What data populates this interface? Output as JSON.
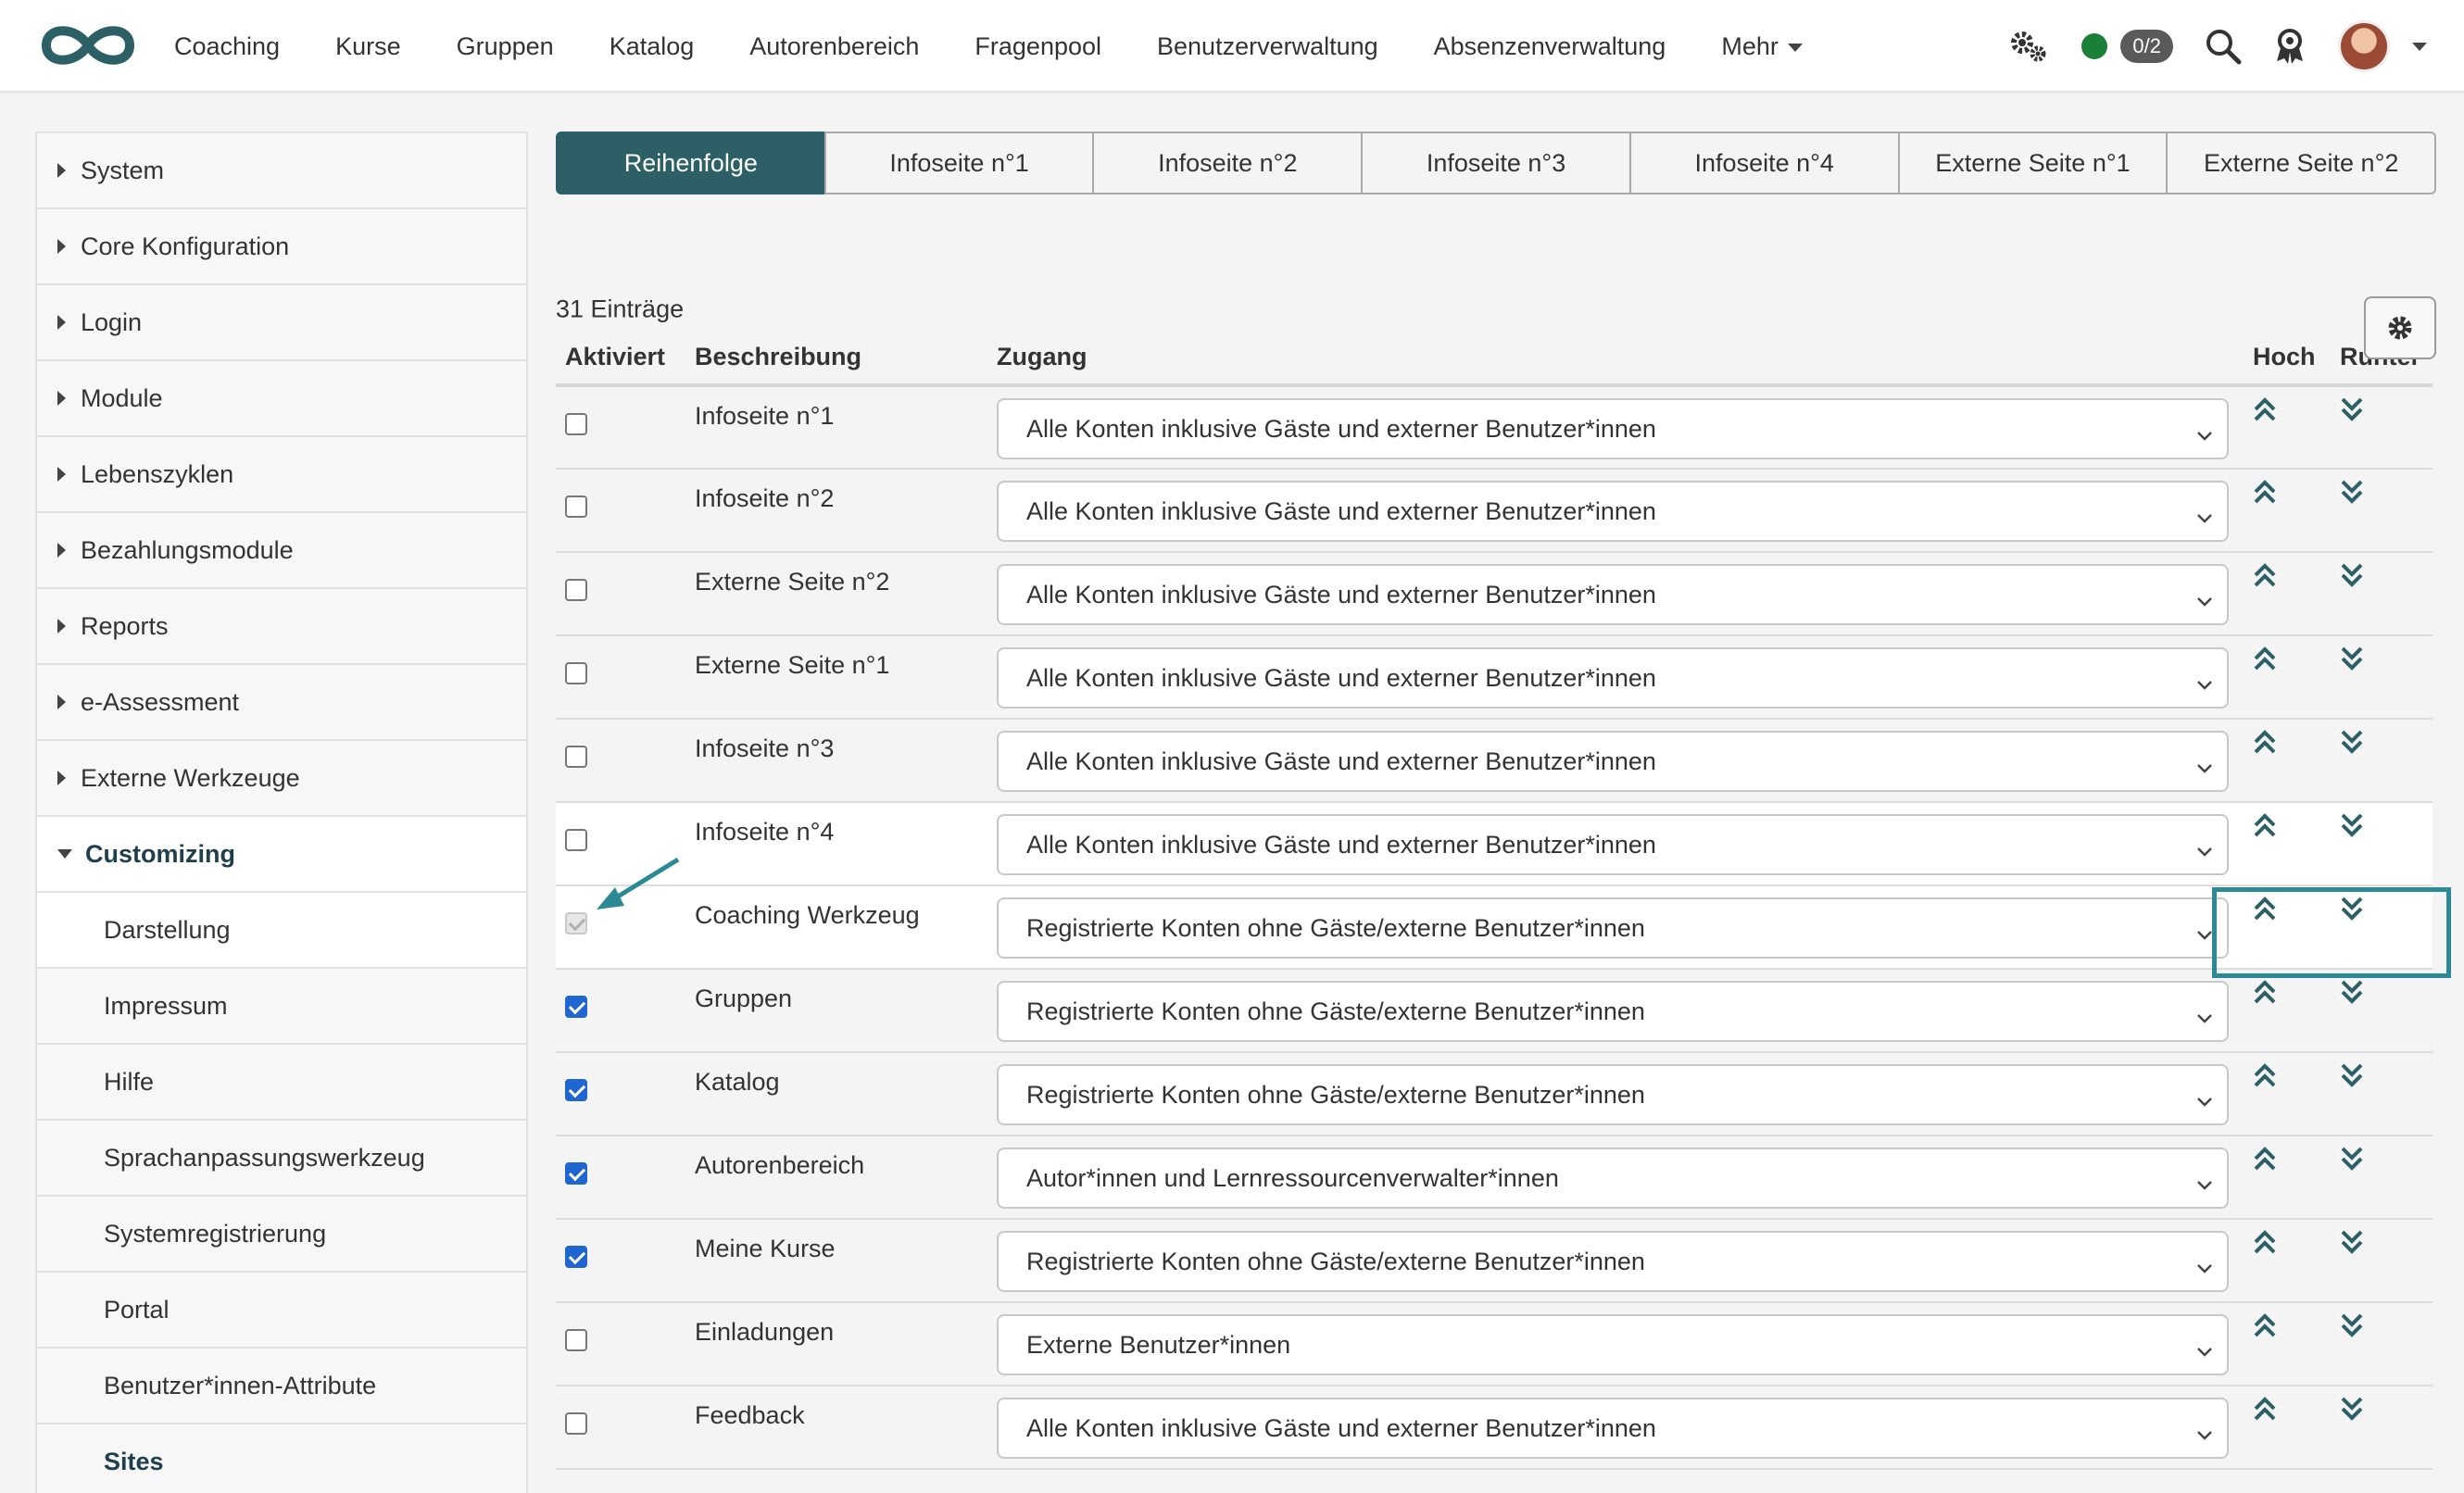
{
  "colors": {
    "accent": "#2c6066",
    "highlight": "#2c8a96",
    "checkbox": "#1f66d0",
    "status_online": "#1a7f37"
  },
  "nav": {
    "items": [
      "Coaching",
      "Kurse",
      "Gruppen",
      "Katalog",
      "Autorenbereich",
      "Fragenpool",
      "Benutzerverwaltung",
      "Absenzenverwaltung"
    ],
    "more_label": "Mehr",
    "badge": "0/2"
  },
  "sidebar": {
    "groups": [
      "System",
      "Core Konfiguration",
      "Login",
      "Module",
      "Lebenszyklen",
      "Bezahlungsmodule",
      "Reports",
      "e-Assessment",
      "Externe Werkzeuge"
    ],
    "open_group": "Customizing",
    "sub_items": [
      "Darstellung",
      "Impressum",
      "Hilfe",
      "Sprachanpassungswerkzeug",
      "Systemregistrierung",
      "Portal",
      "Benutzer*innen-Attribute"
    ],
    "active_sub": "Sites"
  },
  "tabs": [
    "Reihenfolge",
    "Infoseite n°1",
    "Infoseite n°2",
    "Infoseite n°3",
    "Infoseite n°4",
    "Externe Seite n°1",
    "Externe Seite n°2"
  ],
  "entries": "31 Einträge",
  "table": {
    "headers": [
      "Aktiviert",
      "Beschreibung",
      "Zugang",
      "Hoch",
      "Runter"
    ],
    "rows": [
      {
        "checked": false,
        "disabled": false,
        "desc": "Infoseite n°1",
        "access": "Alle Konten inklusive Gäste und externer Benutzer*innen"
      },
      {
        "checked": false,
        "disabled": false,
        "desc": "Infoseite n°2",
        "access": "Alle Konten inklusive Gäste und externer Benutzer*innen"
      },
      {
        "checked": false,
        "disabled": false,
        "desc": "Externe Seite n°2",
        "access": "Alle Konten inklusive Gäste und externer Benutzer*innen"
      },
      {
        "checked": false,
        "disabled": false,
        "desc": "Externe Seite n°1",
        "access": "Alle Konten inklusive Gäste und externer Benutzer*innen"
      },
      {
        "checked": false,
        "disabled": false,
        "desc": "Infoseite n°3",
        "access": "Alle Konten inklusive Gäste und externer Benutzer*innen"
      },
      {
        "checked": false,
        "disabled": false,
        "desc": "Infoseite n°4",
        "access": "Alle Konten inklusive Gäste und externer Benutzer*innen"
      },
      {
        "checked": true,
        "disabled": true,
        "desc": "Coaching Werkzeug",
        "access": "Registrierte Konten ohne Gäste/externe Benutzer*innen"
      },
      {
        "checked": true,
        "disabled": false,
        "desc": "Gruppen",
        "access": "Registrierte Konten ohne Gäste/externe Benutzer*innen"
      },
      {
        "checked": true,
        "disabled": false,
        "desc": "Katalog",
        "access": "Registrierte Konten ohne Gäste/externe Benutzer*innen"
      },
      {
        "checked": true,
        "disabled": false,
        "desc": "Autorenbereich",
        "access": "Autor*innen und Lernressourcenverwalter*innen"
      },
      {
        "checked": true,
        "disabled": false,
        "desc": "Meine Kurse",
        "access": "Registrierte Konten ohne Gäste/externe Benutzer*innen"
      },
      {
        "checked": false,
        "disabled": false,
        "desc": "Einladungen",
        "access": "Externe Benutzer*innen"
      },
      {
        "checked": false,
        "disabled": false,
        "desc": "Feedback",
        "access": "Alle Konten inklusive Gäste und externer Benutzer*innen"
      }
    ]
  }
}
